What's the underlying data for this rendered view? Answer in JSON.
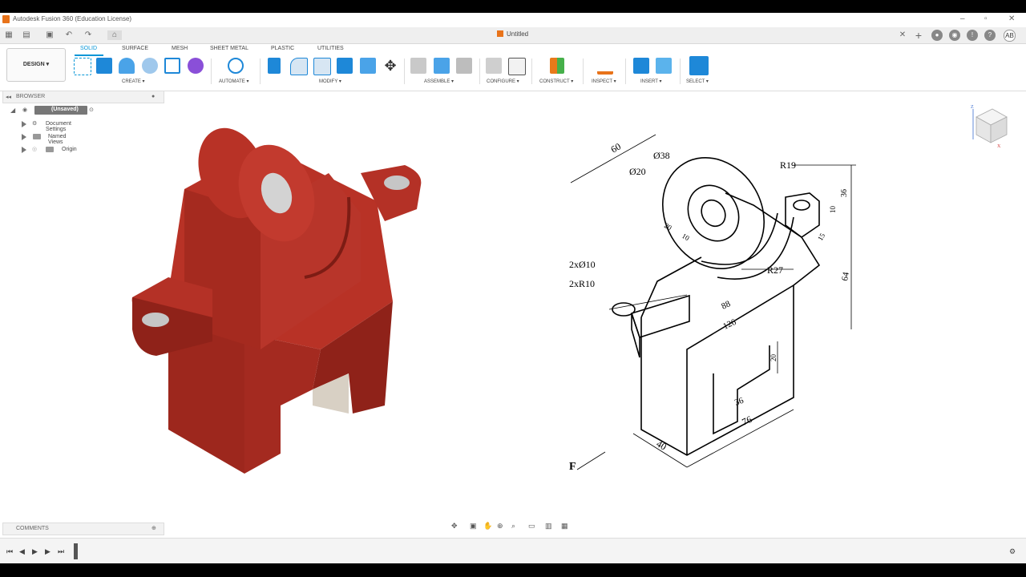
{
  "window": {
    "title": "Autodesk Fusion 360 (Education License)"
  },
  "document": {
    "tab_title": "Untitled"
  },
  "user": {
    "initials": "AB"
  },
  "workspace": {
    "label": "DESIGN ▾"
  },
  "ribbon": {
    "tabs": [
      "SOLID",
      "SURFACE",
      "MESH",
      "SHEET METAL",
      "PLASTIC",
      "UTILITIES"
    ],
    "active_tab": "SOLID",
    "groups": [
      "CREATE ▾",
      "AUTOMATE ▾",
      "MODIFY ▾",
      "ASSEMBLE ▾",
      "CONFIGURE ▾",
      "CONSTRUCT ▾",
      "INSPECT ▾",
      "INSERT ▾",
      "SELECT ▾"
    ]
  },
  "browser": {
    "title": "BROWSER",
    "root": "(Unsaved)",
    "items": [
      "Document Settings",
      "Named Views",
      "Origin"
    ]
  },
  "comments": {
    "title": "COMMENTS"
  },
  "drawing": {
    "dims": {
      "d60": "60",
      "d38": "Ø38",
      "d20": "Ø20",
      "r19": "R19",
      "d36a": "36",
      "d10a": "10",
      "d15": "15",
      "d64": "64",
      "holes": "2xØ10",
      "radius": "2xR10",
      "d20b": "20",
      "d10b": "10",
      "r27": "R27",
      "d88": "88",
      "d126": "126",
      "d20c": "20",
      "d36b": "36",
      "d76": "76",
      "d40": "40",
      "front": "F"
    }
  },
  "colors": {
    "accent": "#0696d7",
    "model_red": "#a8281e",
    "fusion_orange": "#e8731a"
  }
}
